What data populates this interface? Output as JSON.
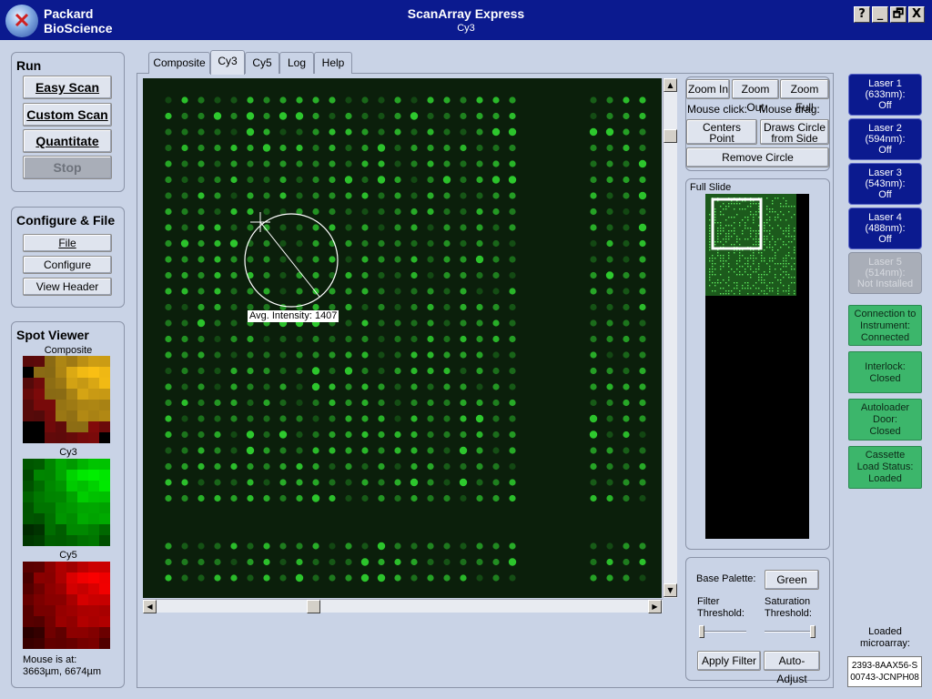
{
  "window": {
    "brand_line1": "Packard",
    "brand_line2": "BioScience",
    "title": "ScanArray Express",
    "subtitle": "Cy3",
    "help_label": "?",
    "minimize_label": "_",
    "restore_label": "🗗",
    "close_label": "X"
  },
  "run": {
    "title": "Run",
    "easy_scan": "Easy Scan",
    "custom_scan": "Custom Scan",
    "quantitate": "Quantitate",
    "stop": "Stop"
  },
  "configure": {
    "title": "Configure & File",
    "file": "File",
    "configure": "Configure",
    "view_header": "View Header"
  },
  "spot_viewer": {
    "title": "Spot Viewer",
    "composite_label": "Composite",
    "cy3_label": "Cy3",
    "cy5_label": "Cy5",
    "mouse_label": "Mouse is at:",
    "mouse_value": "3663µm, 6674µm"
  },
  "tabs": [
    {
      "label": "Composite",
      "active": false
    },
    {
      "label": "Cy3",
      "active": true
    },
    {
      "label": "Cy5",
      "active": false
    },
    {
      "label": "Log",
      "active": false
    },
    {
      "label": "Help",
      "active": false
    }
  ],
  "image": {
    "intensity_label": "Avg. Intensity: 1407",
    "spot_color": "#2fd02f"
  },
  "zoom": {
    "zoom_in": "Zoom In",
    "zoom_out": "Zoom Out",
    "zoom_full": "Zoom Full",
    "mouse_click": "Mouse click:",
    "mouse_drag": "Mouse drag:",
    "centers_point_1": "Centers",
    "centers_point_2": "Point",
    "draws_circle_1": "Draws Circle",
    "draws_circle_2": "from Side",
    "remove_circle": "Remove Circle"
  },
  "full_slide": {
    "title": "Full Slide"
  },
  "palette": {
    "base_palette_label": "Base Palette:",
    "base_palette_value": "Green",
    "filter_label_1": "Filter",
    "filter_label_2": "Threshold:",
    "saturation_label_1": "Saturation",
    "saturation_label_2": "Threshold:",
    "filter_value": 0.0,
    "saturation_value": 1.0,
    "apply_filter": "Apply Filter",
    "auto_adjust": "Auto-Adjust"
  },
  "lasers": [
    {
      "l1": "Laser 1",
      "l2": "(633nm):",
      "l3": "Off",
      "installed": true
    },
    {
      "l1": "Laser 2",
      "l2": "(594nm):",
      "l3": "Off",
      "installed": true
    },
    {
      "l1": "Laser 3",
      "l2": "(543nm):",
      "l3": "Off",
      "installed": true
    },
    {
      "l1": "Laser 4",
      "l2": "(488nm):",
      "l3": "Off",
      "installed": true
    },
    {
      "l1": "Laser 5",
      "l2": "(514nm):",
      "l3": "Not Installed",
      "installed": false
    }
  ],
  "status": [
    {
      "l1": "Connection to",
      "l2": "Instrument:",
      "l3": "Connected"
    },
    {
      "l1": "Interlock:",
      "l2": "Closed",
      "l3": ""
    },
    {
      "l1": "Autoloader",
      "l2": "Door:",
      "l3": "Closed"
    },
    {
      "l1": "Cassette",
      "l2": "Load Status:",
      "l3": "Loaded"
    }
  ],
  "loaded": {
    "label_1": "Loaded",
    "label_2": "microarray:",
    "value_1": "2393-8AAX56-S",
    "value_2": "00743-JCNPH08"
  },
  "colors": {
    "title_bar": "#0b1a8f",
    "laser_on_bg": "#0b1a8f",
    "status_bg": "#3cb66b"
  }
}
